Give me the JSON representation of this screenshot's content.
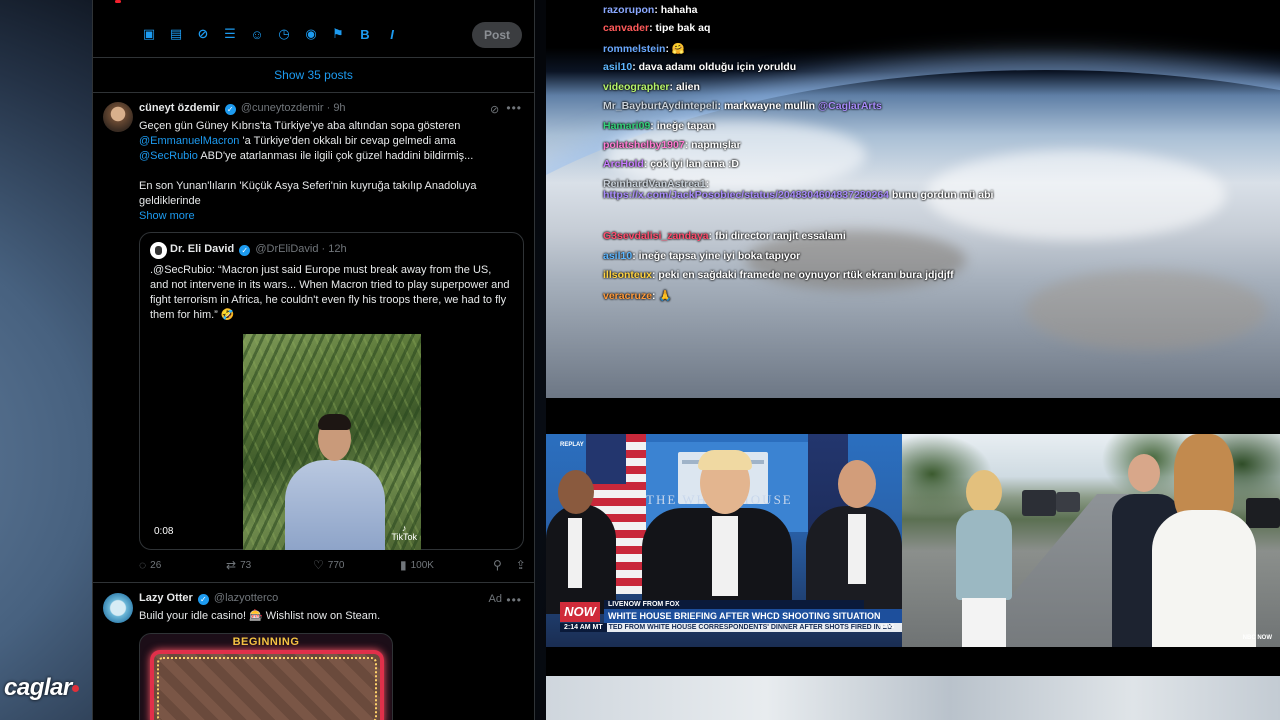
{
  "compose": {
    "post_label": "Post",
    "tools": [
      "media-icon",
      "gif-icon",
      "grok-icon",
      "poll-icon",
      "emoji-icon",
      "schedule-icon",
      "location-icon",
      "flag-icon",
      "bold-icon",
      "italic-icon"
    ]
  },
  "timeline": {
    "show_posts": "Show 35 posts"
  },
  "tweet1": {
    "name": "cüneyt özdemir",
    "handle": "@cuneytozdemir",
    "sep": "·",
    "time": "9h",
    "line1": "Geçen gün Güney Kıbrıs'ta Türkiye'ye aba altından sopa gösteren",
    "mention1": "@EmmanuelMacron",
    "line2": " 'a Türkiye'den okkalı bir cevap gelmedi ama",
    "mention2": "@SecRubio",
    "line3": " ABD'ye atarlanması ile ilgili çok güzel haddini bildirmiş...",
    "line4": "En son Yunan'lıların 'Küçük Asya Seferi'nin kuyruğa takılıp Anadoluya geldiklerinde",
    "show_more": "Show more",
    "quote": {
      "name": "Dr. Eli David",
      "handle": "@DrEliDavid",
      "sep": "·",
      "time": "12h",
      "text": ".@SecRubio: “Macron just said Europe must break away from the US, and not intervene in its wars... When Macron tried to play superpower and fight terrorism in Africa, he couldn't even fly his troops there, we had to fly them for him.” 🤣",
      "video_time": "0:08",
      "video_watermark": "TikTok"
    },
    "replies": "26",
    "reposts": "73",
    "likes": "770",
    "views": "100K"
  },
  "tweet2": {
    "name": "Lazy Otter",
    "handle": "@lazyotterco",
    "ad_label": "Ad",
    "text": "Build your idle casino! 🎰 Wishlist now on Steam.",
    "game_title": "BEGINNING"
  },
  "chat": [
    {
      "user": "razorupon",
      "msg": ": hahaha",
      "color": "#8aa8ff"
    },
    {
      "user": "canvader",
      "msg": ": tipe bak aq",
      "color": "#ff5a5a"
    },
    {
      "user": "rommelstein",
      "msg": ": 🤗",
      "color": "#6aa9ff"
    },
    {
      "user": "asil10",
      "msg": ": dava adamı olduğu için yoruldu",
      "color": "#5fb7ff"
    },
    {
      "user": "videographer",
      "msg": ": alien",
      "color": "#b6f36a"
    },
    {
      "user": "Mr_BayburtAydintepeli",
      "msg": ": markwayne mullin ",
      "extra": "@CaglarArts",
      "color": "#c9d1d9"
    },
    {
      "user": "Hamari09",
      "msg": ": ineğe tapan",
      "color": "#34d27a"
    },
    {
      "user": "polatshelby1907",
      "msg": ": napmışlar",
      "color": "#ff7ad1"
    },
    {
      "user": "ArcHold",
      "msg": ": çok iyi lan ama :D",
      "color": "#c77dff"
    },
    {
      "user": "ReinhardVanAstrea1",
      "msg": ":",
      "color": "#c9d1d9"
    },
    {
      "user": "https://x.com/JackPosobiec/status/2048304604837280264",
      "msg": " bunu gordun mü abi",
      "color": "#a78bfa"
    },
    {
      "user": "G3sevdalisi_zandaya",
      "msg": ": fbi director ranjit essalami",
      "color": "#ff4d6d"
    },
    {
      "user": "asil10",
      "msg": ": ineğe tapsa yine iyi boka tapıyor",
      "color": "#5fb7ff"
    },
    {
      "user": "illsonteux",
      "msg": ": peki en sağdaki framede ne oynuyor rtük ekranı bura jdjdjff",
      "color": "#ffd23f"
    },
    {
      "user": "veracruze",
      "msg": ": 🙏",
      "color": "#ff9a3c"
    }
  ],
  "news": {
    "replay": "REPLAY",
    "live_from": "LIVENOW FROM FOX",
    "now_logo": "NOW",
    "headline": "WHITE HOUSE BRIEFING AFTER WHCD SHOOTING SITUATION",
    "time": "2:14 AM MT",
    "ticker": "TED FROM WHITE HOUSE CORRESPONDENTS' DINNER AFTER SHOTS FIRED IN LO",
    "channel": "NEWS",
    "backdrop": "THE WHITE HOUSE"
  },
  "outdoor": {
    "network": "NBC NOW"
  },
  "brand": {
    "text": "caglar"
  }
}
